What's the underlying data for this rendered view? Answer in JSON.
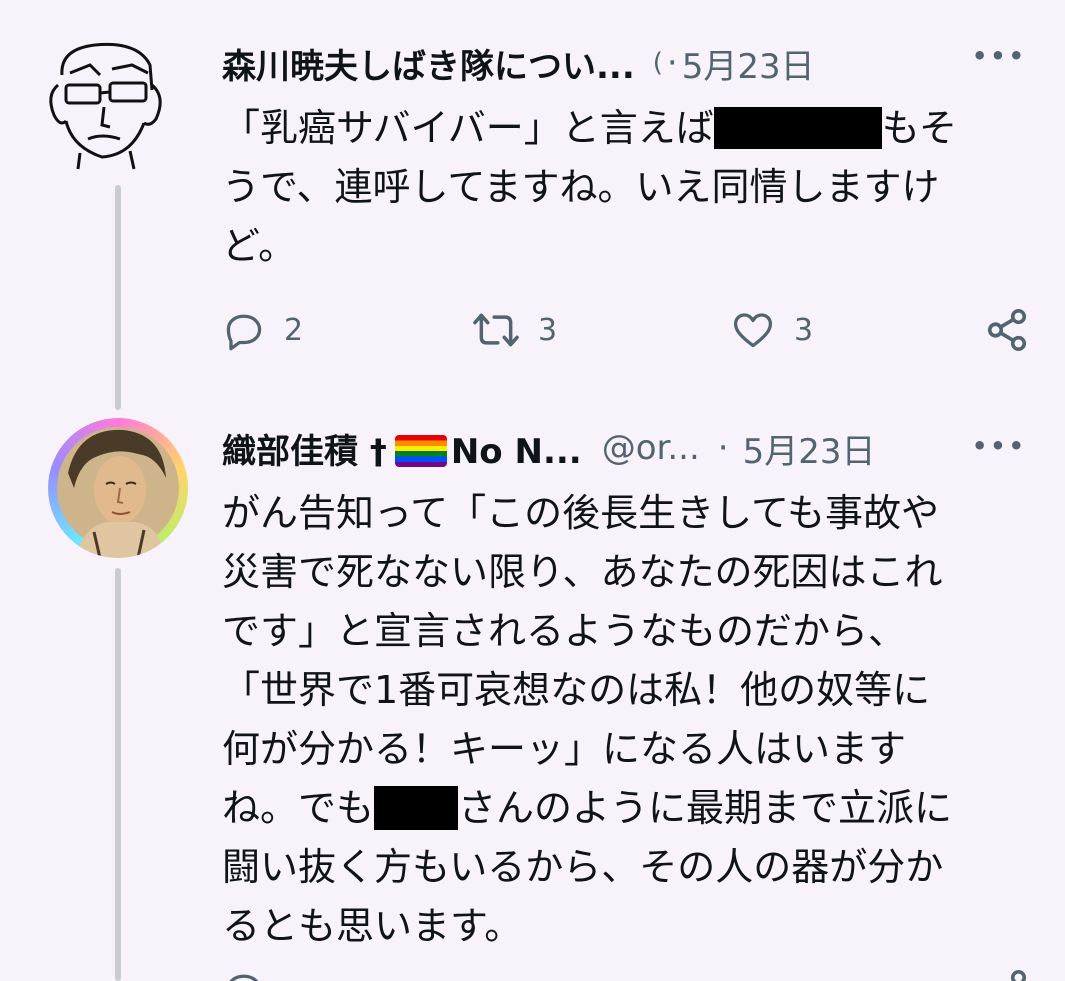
{
  "tweets": [
    {
      "name": "森川暁夫しばき隊につい...",
      "handle_fragment": "(",
      "separator": "·",
      "date": "5月23日",
      "body_lines": [
        {
          "pre": "「乳癌サバイバー」と言えば",
          "post": "もそ"
        },
        {
          "text": "うで、連呼してますね。いえ同情しますけ"
        },
        {
          "text": "ど。"
        }
      ],
      "reply_count": "2",
      "retweet_count": "3",
      "like_count": "3",
      "avatar_icon": "cartoon-face-avatar"
    },
    {
      "name_prefix": "織部佳積 †",
      "name_suffix": "No N...",
      "handle": "@or...",
      "separator": "·",
      "date": "5月23日",
      "body_lines": [
        {
          "text": "がん告知って「この後長生きしても事故や"
        },
        {
          "text": "災害で死なない限り、あなたの死因はこれ"
        },
        {
          "text": "です」と宣言されるようなものだから、"
        },
        {
          "text": "「世界で1番可哀想なのは私！他の奴等に"
        },
        {
          "text": "何が分かる！キーッ」になる人はいます"
        },
        {
          "pre": "ね。でも",
          "post": "さんのように最期まで立派に"
        },
        {
          "text": "闘い抜く方もいるから、その人の器が分か"
        },
        {
          "text": "るとも思います。"
        }
      ],
      "avatar_icon": "portrait-avatar-rainbow-ring"
    }
  ],
  "more_label": "•••",
  "colors": {
    "background": "#f8f3fa",
    "text": "#0f1419",
    "muted": "#536471",
    "thread_line": "#c9cdd2"
  }
}
